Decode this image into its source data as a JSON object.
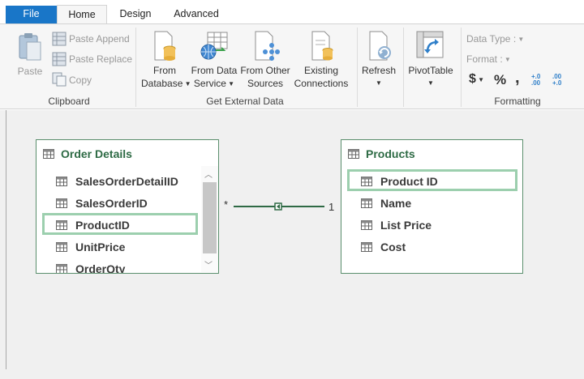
{
  "tabs": {
    "file": "File",
    "home": "Home",
    "design": "Design",
    "advanced": "Advanced"
  },
  "ribbon": {
    "clipboard": {
      "paste": "Paste",
      "paste_append": "Paste Append",
      "paste_replace": "Paste Replace",
      "copy": "Copy",
      "group_label": "Clipboard"
    },
    "external": {
      "from_db_line1": "From",
      "from_db_line2": "Database",
      "from_ds_line1": "From Data",
      "from_ds_line2": "Service",
      "from_other_line1": "From Other",
      "from_other_line2": "Sources",
      "existing_line1": "Existing",
      "existing_line2": "Connections",
      "group_label": "Get External Data"
    },
    "refresh": "Refresh",
    "pivottable": "PivotTable",
    "formatting": {
      "data_type": "Data Type :",
      "format": "Format :",
      "dollar": "$",
      "percent": "%",
      "comma": ",",
      "inc_decimal": "+.0 .00",
      "dec_decimal": ".00 +.0",
      "group_label": "Formatting"
    }
  },
  "diagram": {
    "order_details": {
      "title": "Order Details",
      "columns": [
        "SalesOrderDetailID",
        "SalesOrderID",
        "ProductID",
        "UnitPrice",
        "OrderQty"
      ]
    },
    "products": {
      "title": "Products",
      "columns": [
        "Product ID",
        "Name",
        "List Price",
        "Cost"
      ]
    },
    "relationship": {
      "many": "*",
      "one": "1"
    }
  },
  "colors": {
    "file_tab": "#1976c8",
    "table_border": "#5b8f6d",
    "table_title": "#2e6b45",
    "highlight": "#9ccfae"
  },
  "icons": [
    "paste-icon",
    "paste-append-icon",
    "paste-replace-icon",
    "copy-icon",
    "database-icon",
    "data-service-icon",
    "other-sources-icon",
    "existing-connections-icon",
    "refresh-icon",
    "pivottable-icon",
    "table-icon",
    "column-icon"
  ]
}
